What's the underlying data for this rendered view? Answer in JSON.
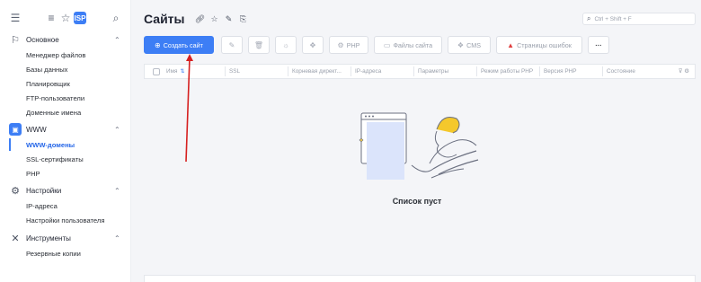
{
  "sidebar": {
    "groups": [
      {
        "title": "Основное",
        "items": [
          "Менеджер файлов",
          "Базы данных",
          "Планировщик",
          "FTP-пользователи",
          "Доменные имена"
        ]
      },
      {
        "title": "WWW",
        "items": [
          "WWW-домены",
          "SSL-сертификаты",
          "PHP"
        ],
        "active_item": "WWW-домены"
      },
      {
        "title": "Настройки",
        "items": [
          "IP-адреса",
          "Настройки пользователя"
        ]
      },
      {
        "title": "Инструменты",
        "items": [
          "Резервные копии"
        ]
      }
    ]
  },
  "header": {
    "title": "Сайты",
    "search_hint": "Ctrl + Shift + F"
  },
  "toolbar": {
    "create_label": "Создать сайт",
    "php_label": "PHP",
    "files_label": "Файлы сайта",
    "cms_label": "CMS",
    "errors_label": "Страницы ошибок",
    "more_label": "···"
  },
  "table": {
    "columns": [
      "Имя",
      "SSL",
      "Корневая директ...",
      "IP-адреса",
      "Параметры",
      "Режим работы PHP",
      "Версия PHP",
      "Состояние"
    ]
  },
  "empty_state": {
    "text": "Список пуст"
  },
  "colors": {
    "accent": "#3d7ef5",
    "annotation_arrow": "#d62020"
  },
  "icons": {
    "create": "plus-circle-icon",
    "edit": "pencil-icon",
    "delete": "trash-icon",
    "lamp": "bulb-icon",
    "ssl": "ribbon-icon",
    "php": "php-icon",
    "files": "folder-icon",
    "cms": "cubes-icon",
    "errors": "warning-icon"
  }
}
